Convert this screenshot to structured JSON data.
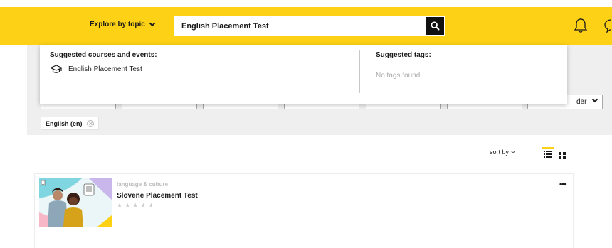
{
  "header": {
    "explore_label": "Explore by topic",
    "search_value": "English Placement Test",
    "icons": [
      "chevron-down-icon",
      "search-icon",
      "bell-icon",
      "chat-icon"
    ],
    "colors": {
      "accent": "#fcd116",
      "dark": "#111111"
    }
  },
  "suggestions": {
    "courses_heading": "Suggested courses and events:",
    "courses": [
      {
        "label": "English Placement Test",
        "icon": "graduation-cap-icon"
      }
    ],
    "tags_heading": "Suggested tags:",
    "tags_empty": "No tags found"
  },
  "filters": {
    "order_label": "der",
    "active_chip": "English (en)"
  },
  "results": {
    "sort_label": "sort by",
    "view_modes": [
      "list",
      "grid"
    ],
    "selected_view": "list",
    "cards": [
      {
        "category": "language & culture",
        "title": "Slovene Placement Test",
        "rating_stars": 5,
        "rating_filled": 0,
        "more_label": "•••"
      }
    ]
  }
}
